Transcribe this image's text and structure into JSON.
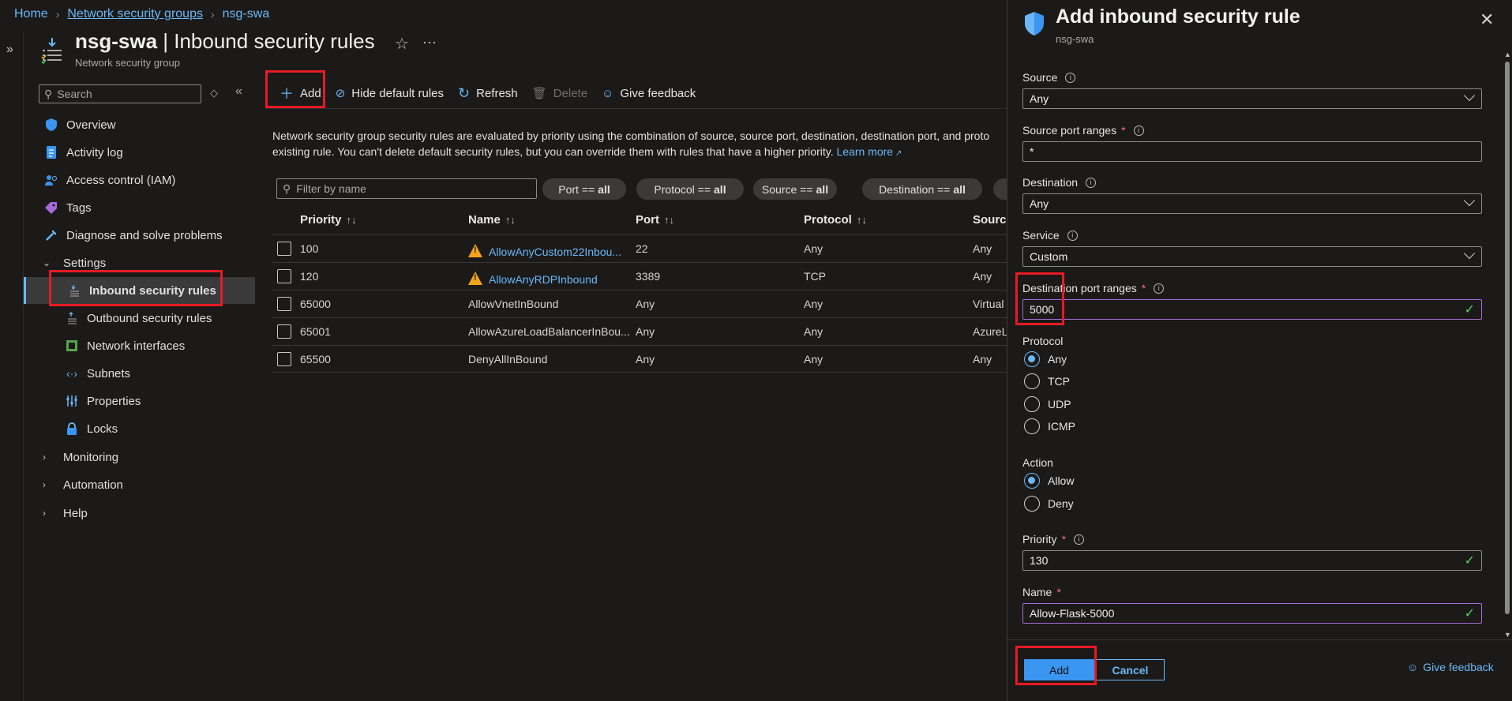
{
  "breadcrumb": {
    "home": "Home",
    "nsg_list": "Network security groups",
    "current": "nsg-swa"
  },
  "header": {
    "resource": "nsg-swa",
    "title_sep": " | ",
    "page": "Inbound security rules",
    "subtitle": "Network security group"
  },
  "sidebar": {
    "search_placeholder": "Search",
    "items": [
      {
        "label": "Overview",
        "icon": "shield-icon"
      },
      {
        "label": "Activity log",
        "icon": "activity-log-icon"
      },
      {
        "label": "Access control (IAM)",
        "icon": "people-icon"
      },
      {
        "label": "Tags",
        "icon": "tag-icon"
      },
      {
        "label": "Diagnose and solve problems",
        "icon": "wrench-icon"
      },
      {
        "label": "Settings",
        "icon": "chevron-down-icon"
      },
      {
        "label": "Inbound security rules",
        "icon": "inbound-rules-icon"
      },
      {
        "label": "Outbound security rules",
        "icon": "outbound-rules-icon"
      },
      {
        "label": "Network interfaces",
        "icon": "network-interface-icon"
      },
      {
        "label": "Subnets",
        "icon": "subnet-icon"
      },
      {
        "label": "Properties",
        "icon": "properties-icon"
      },
      {
        "label": "Locks",
        "icon": "lock-icon"
      },
      {
        "label": "Monitoring",
        "icon": "chevron-right-icon"
      },
      {
        "label": "Automation",
        "icon": "chevron-right-icon"
      },
      {
        "label": "Help",
        "icon": "chevron-right-icon"
      }
    ]
  },
  "toolbar": {
    "add": "Add",
    "hide_default": "Hide default rules",
    "refresh": "Refresh",
    "delete": "Delete",
    "feedback": "Give feedback"
  },
  "description": {
    "line1": "Network security group security rules are evaluated by priority using the combination of source, source port, destination, destination port, and proto",
    "line2": "existing rule. You can't delete default security rules, but you can override them with rules that have a higher priority.",
    "learn_more": "Learn more"
  },
  "filters": {
    "placeholder": "Filter by name",
    "pills": [
      {
        "key": "Port ==",
        "val": "all"
      },
      {
        "key": "Protocol ==",
        "val": "all"
      },
      {
        "key": "Source ==",
        "val": "all"
      },
      {
        "key": "Destination ==",
        "val": "all"
      }
    ]
  },
  "table": {
    "headers": [
      "Priority",
      "Name",
      "Port",
      "Protocol",
      "Source"
    ],
    "rows": [
      {
        "priority": "100",
        "name": "AllowAnyCustom22Inbou...",
        "port": "22",
        "protocol": "Any",
        "source": "Any",
        "warning": true,
        "link": true
      },
      {
        "priority": "120",
        "name": "AllowAnyRDPInbound",
        "port": "3389",
        "protocol": "TCP",
        "source": "Any",
        "warning": true,
        "link": true
      },
      {
        "priority": "65000",
        "name": "AllowVnetInBound",
        "port": "Any",
        "protocol": "Any",
        "source": "Virtual",
        "warning": false,
        "link": false
      },
      {
        "priority": "65001",
        "name": "AllowAzureLoadBalancerInBou...",
        "port": "Any",
        "protocol": "Any",
        "source": "AzureL",
        "warning": false,
        "link": false
      },
      {
        "priority": "65500",
        "name": "DenyAllInBound",
        "port": "Any",
        "protocol": "Any",
        "source": "Any",
        "warning": false,
        "link": false
      }
    ]
  },
  "panel": {
    "title": "Add inbound security rule",
    "subtitle": "nsg-swa",
    "source_label": "Source",
    "source_value": "Any",
    "source_port_label": "Source port ranges",
    "source_port_value": "*",
    "destination_label": "Destination",
    "destination_value": "Any",
    "service_label": "Service",
    "service_value": "Custom",
    "dest_port_label": "Destination port ranges",
    "dest_port_value": "5000",
    "protocol_label": "Protocol",
    "protocols": [
      "Any",
      "TCP",
      "UDP",
      "ICMP"
    ],
    "protocol_selected": "Any",
    "action_label": "Action",
    "actions": [
      "Allow",
      "Deny"
    ],
    "action_selected": "Allow",
    "priority_label": "Priority",
    "priority_value": "130",
    "name_label": "Name",
    "name_value": "Allow-Flask-5000",
    "add_button": "Add",
    "cancel_button": "Cancel",
    "feedback": "Give feedback"
  }
}
